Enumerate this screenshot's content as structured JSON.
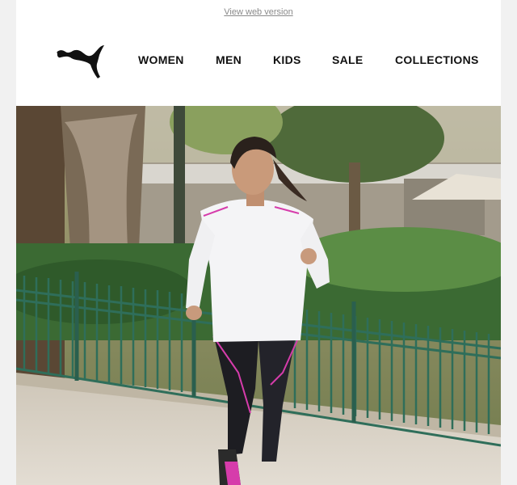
{
  "header": {
    "view_web_version": "View web version",
    "logo_icon": "puma-cat-logo-icon"
  },
  "nav": {
    "items": [
      {
        "label": "WOMEN"
      },
      {
        "label": "MEN"
      },
      {
        "label": "KIDS"
      },
      {
        "label": "SALE"
      },
      {
        "label": "COLLECTIONS"
      }
    ]
  },
  "hero": {
    "image_subject": "woman jogging in park"
  },
  "colors": {
    "background": "#f1f1f1",
    "nav_text": "#111111",
    "link_text": "#8a8a8a",
    "accent_pink": "#d63cab"
  }
}
